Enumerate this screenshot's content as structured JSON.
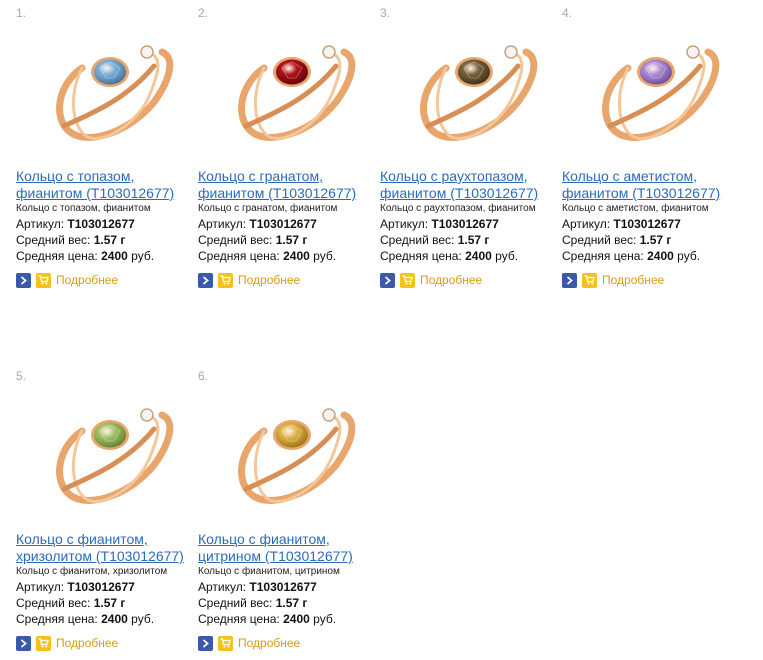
{
  "products": [
    {
      "num": "1.",
      "title_line1": "Кольцо с топазом,",
      "title_line2": "фианитом (T103012677)",
      "desc": "Кольцо с топазом, фианитом",
      "article_label": "Артикул:",
      "article_value": "T103012677",
      "weight_label": "Средний вес:",
      "weight_value": "1.57 г",
      "price_label": "Средняя цена:",
      "price_value": "2400",
      "price_unit": "руб.",
      "more_label": "Подробнее",
      "gem_color": "#7fb2d8",
      "gem_dark": "#3d6f9a",
      "gem_name": "topaz"
    },
    {
      "num": "2.",
      "title_line1": "Кольцо с гранатом,",
      "title_line2": "фианитом (T103012677)",
      "desc": "Кольцо с гранатом, фианитом",
      "article_label": "Артикул:",
      "article_value": "T103012677",
      "weight_label": "Средний вес:",
      "weight_value": "1.57 г",
      "price_label": "Средняя цена:",
      "price_value": "2400",
      "price_unit": "руб.",
      "more_label": "Подробнее",
      "gem_color": "#b0121a",
      "gem_dark": "#5e0408",
      "gem_name": "garnet"
    },
    {
      "num": "3.",
      "title_line1": "Кольцо с раухтопазом,",
      "title_line2": "фианитом (T103012677)",
      "desc": "Кольцо с раухтопазом, фианитом",
      "article_label": "Артикул:",
      "article_value": "T103012677",
      "weight_label": "Средний вес:",
      "weight_value": "1.57 г",
      "price_label": "Средняя цена:",
      "price_value": "2400",
      "price_unit": "руб.",
      "more_label": "Подробнее",
      "gem_color": "#7a6540",
      "gem_dark": "#3b2d16",
      "gem_name": "smoky-quartz"
    },
    {
      "num": "4.",
      "title_line1": "Кольцо с аметистом,",
      "title_line2": "фианитом (T103012677)",
      "desc": "Кольцо с аметистом, фианитом",
      "article_label": "Артикул:",
      "article_value": "T103012677",
      "weight_label": "Средний вес:",
      "weight_value": "1.57 г",
      "price_label": "Средняя цена:",
      "price_value": "2400",
      "price_unit": "руб.",
      "more_label": "Подробнее",
      "gem_color": "#b08fd6",
      "gem_dark": "#6a4a98",
      "gem_name": "amethyst"
    },
    {
      "num": "5.",
      "title_line1": "Кольцо с фианитом,",
      "title_line2": "хризолитом (T103012677)",
      "desc": "Кольцо с фианитом, хризолитом",
      "article_label": "Артикул:",
      "article_value": "T103012677",
      "weight_label": "Средний вес:",
      "weight_value": "1.57 г",
      "price_label": "Средняя цена:",
      "price_value": "2400",
      "price_unit": "руб.",
      "more_label": "Подробнее",
      "gem_color": "#a6c46a",
      "gem_dark": "#5f7d2a",
      "gem_name": "chrysolite"
    },
    {
      "num": "6.",
      "title_line1": "Кольцо с фианитом,",
      "title_line2": "цитрином (T103012677)",
      "desc": "Кольцо с фианитом, цитрином",
      "article_label": "Артикул:",
      "article_value": "T103012677",
      "weight_label": "Средний вес:",
      "weight_value": "1.57 г",
      "price_label": "Средняя цена:",
      "price_value": "2400",
      "price_unit": "руб.",
      "more_label": "Подробнее",
      "gem_color": "#e0b64a",
      "gem_dark": "#9a7214",
      "gem_name": "citrine"
    }
  ],
  "colors": {
    "link": "#2c6bb8",
    "gold": "#e8a56c",
    "more": "#d99c10",
    "arrow_button": "#3a59a8",
    "cart_button": "#f5c21c"
  },
  "icons": {
    "details": "chevron-right-icon",
    "cart": "cart-icon"
  }
}
